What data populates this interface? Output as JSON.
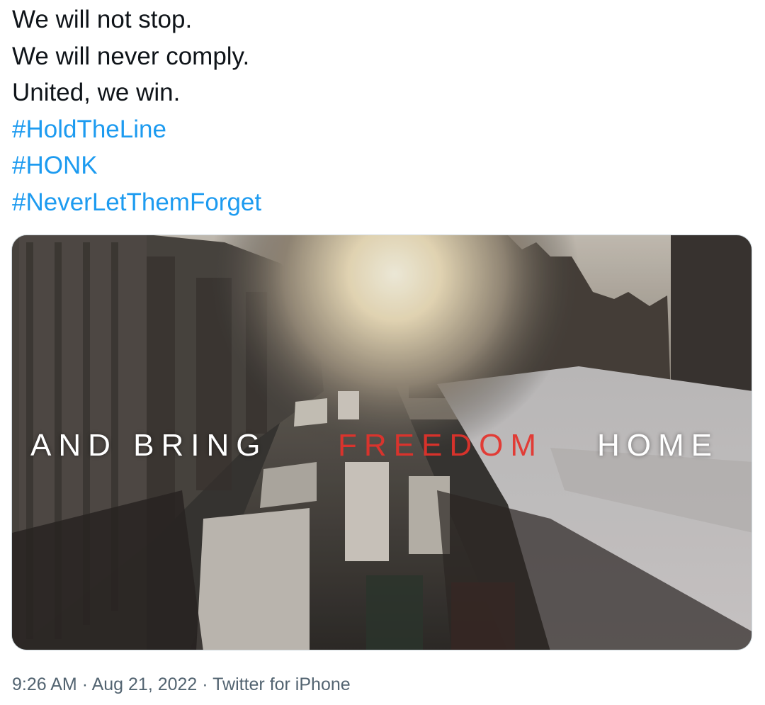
{
  "tweet": {
    "lines": [
      "We will not stop.",
      "We will never comply.",
      "United, we win."
    ],
    "hashtags": [
      "#HoldTheLine",
      "#HONK",
      "#NeverLetThemForget"
    ]
  },
  "media": {
    "caption": {
      "part1": "AND BRING",
      "part2": "FREEDOM",
      "part3": "HOME"
    },
    "colors": {
      "caption_text": "#ffffff",
      "caption_highlight": "#e5322b"
    }
  },
  "meta": {
    "time": "9:26 AM",
    "date": "Aug 21, 2022",
    "source": "Twitter for iPhone",
    "separator": "·"
  },
  "colors": {
    "text": "#0f1419",
    "hashtag": "#1d9bf0",
    "meta": "#536471"
  }
}
